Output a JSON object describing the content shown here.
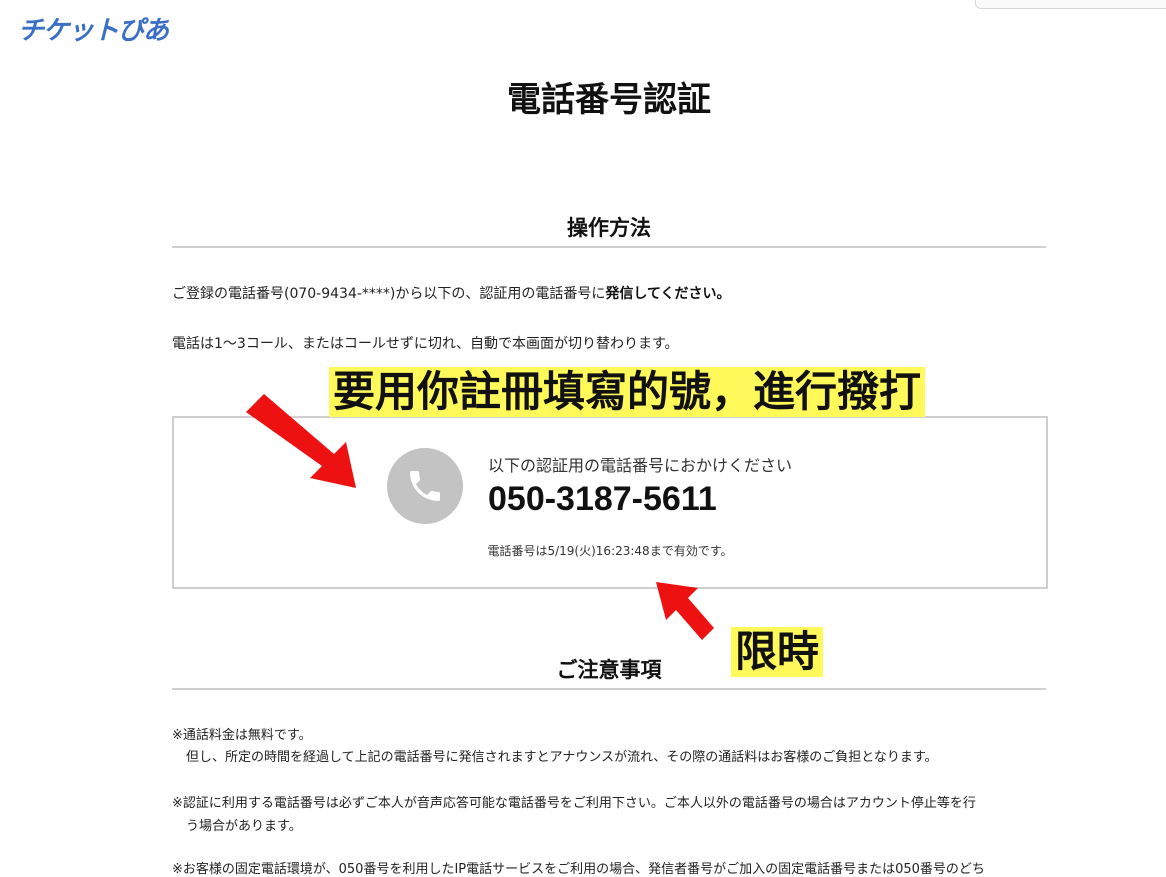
{
  "header": {
    "logo_text": "チケットぴあ"
  },
  "page": {
    "title": "電話番号認証"
  },
  "operation": {
    "heading": "操作方法",
    "line1_prefix": "ご登録の電話番号(070-9434-****)から以下の、認証用の電話番号に",
    "line1_bold": "発信してください。",
    "line2": "電話は1〜3コール、またはコールせずに切れ、自動で本画面が切り替わります。"
  },
  "callbox": {
    "icon": "phone-icon",
    "label": "以下の認証用の電話番号におかけください",
    "number": "050-3187-5611",
    "valid_until": "電話番号は5/19(火)16:23:48まで有効です。"
  },
  "annotations": {
    "main": "要用你註冊填寫的號，進行撥打",
    "limit": "限時",
    "highlight_color": "#fff95a",
    "arrow_color": "#ee1111"
  },
  "notes": {
    "heading": "ご注意事項",
    "items": [
      {
        "line1": "※通話料金は無料です。",
        "line2": "但し、所定の時間を経過して上記の電話番号に発信されますとアナウンスが流れ、その際の通話料はお客様のご負担となります。"
      },
      {
        "line1": "※認証に利用する電話番号は必ずご本人が音声応答可能な電話番号をご利用下さい。ご本人以外の電話番号の場合はアカウント停止等を行",
        "line2": "う場合があります。"
      },
      {
        "line1": "※お客様の固定電話環境が、050番号を利用したIP電話サービスをご利用の場合、発信者番号がご加入の固定電話番号または050番号のどち"
      }
    ]
  }
}
